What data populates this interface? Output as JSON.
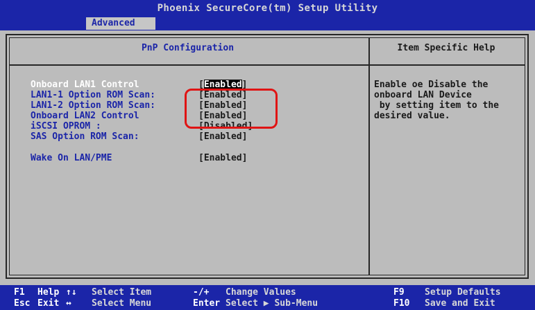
{
  "header": {
    "title": "Phoenix SecureCore(tm) Setup Utility",
    "active_tab": "Advanced"
  },
  "main": {
    "section_title": "PnP Configuration",
    "help_title": "Item Specific Help",
    "items": [
      {
        "label": "Onboard LAN1 Control",
        "value_open": "[",
        "value_text": "Enabled",
        "value_close": "]"
      },
      {
        "label": "LAN1-1 Option ROM Scan:",
        "value": "[Enabled]"
      },
      {
        "label": "LAN1-2 Option ROM Scan:",
        "value": "[Enabled]"
      },
      {
        "label": "Onboard LAN2 Control",
        "value": "[Enabled]"
      },
      {
        "label": "iSCSI OPROM :",
        "value": "[Disabled]"
      },
      {
        "label": "SAS Option ROM Scan:",
        "value": "[Enabled]"
      },
      {
        "label": "Wake On LAN/PME",
        "value": "[Enabled]"
      }
    ],
    "help_text": "Enable oe Disable the\nonboard LAN Device\n by setting item to the\ndesired value."
  },
  "footer": {
    "row1": [
      {
        "key": "F1",
        "desc": "Help"
      },
      {
        "key": "↑↓",
        "desc": "Select Item"
      },
      {
        "key": "-/+",
        "desc": "Change Values"
      },
      {
        "key": "F9",
        "desc": "Setup Defaults"
      }
    ],
    "row2": [
      {
        "key": "Esc",
        "desc": "Exit"
      },
      {
        "key": "↔",
        "desc": "Select Menu"
      },
      {
        "key": "Enter",
        "desc": "Select ▶ Sub-Menu"
      },
      {
        "key": "F10",
        "desc": "Save and Exit"
      }
    ]
  },
  "colors": {
    "background": "#bcbcbc",
    "bar_blue": "#1b25a8",
    "item_blue": "#1b25a8",
    "annotation_red": "#e01414"
  }
}
